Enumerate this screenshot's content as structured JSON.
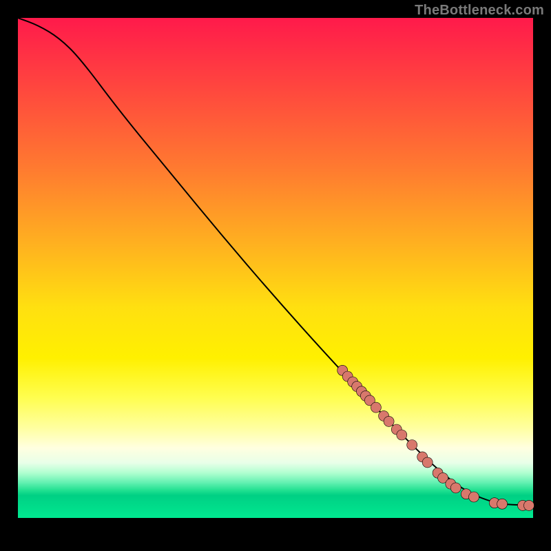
{
  "watermark": "TheBottleneck.com",
  "chart_data": {
    "type": "line",
    "title": "",
    "xlabel": "",
    "ylabel": "",
    "xlim": [
      0,
      100
    ],
    "ylim": [
      0,
      100
    ],
    "curve": [
      {
        "x": 0,
        "y": 100
      },
      {
        "x": 4,
        "y": 98.5
      },
      {
        "x": 8,
        "y": 96
      },
      {
        "x": 12,
        "y": 92
      },
      {
        "x": 20,
        "y": 81
      },
      {
        "x": 30,
        "y": 68.5
      },
      {
        "x": 40,
        "y": 56
      },
      {
        "x": 50,
        "y": 44
      },
      {
        "x": 60,
        "y": 32.5
      },
      {
        "x": 70,
        "y": 21.5
      },
      {
        "x": 78,
        "y": 13
      },
      {
        "x": 84,
        "y": 7.5
      },
      {
        "x": 88,
        "y": 4.8
      },
      {
        "x": 92,
        "y": 3.2
      },
      {
        "x": 95,
        "y": 2.7
      },
      {
        "x": 97,
        "y": 2.6
      },
      {
        "x": 100,
        "y": 2.5
      }
    ],
    "series": [
      {
        "name": "points",
        "color": "#d8786c",
        "data": [
          {
            "x": 63.0,
            "y": 29.5
          },
          {
            "x": 64.0,
            "y": 28.3
          },
          {
            "x": 65.0,
            "y": 27.2
          },
          {
            "x": 65.8,
            "y": 26.3
          },
          {
            "x": 66.7,
            "y": 25.3
          },
          {
            "x": 67.5,
            "y": 24.4
          },
          {
            "x": 68.3,
            "y": 23.5
          },
          {
            "x": 69.5,
            "y": 22.1
          },
          {
            "x": 71.0,
            "y": 20.4
          },
          {
            "x": 72.0,
            "y": 19.3
          },
          {
            "x": 73.5,
            "y": 17.7
          },
          {
            "x": 74.5,
            "y": 16.6
          },
          {
            "x": 76.5,
            "y": 14.6
          },
          {
            "x": 78.5,
            "y": 12.2
          },
          {
            "x": 79.5,
            "y": 11.1
          },
          {
            "x": 81.5,
            "y": 9.0
          },
          {
            "x": 82.5,
            "y": 8.0
          },
          {
            "x": 84.0,
            "y": 6.8
          },
          {
            "x": 85.0,
            "y": 6.0
          },
          {
            "x": 87.0,
            "y": 4.8
          },
          {
            "x": 88.5,
            "y": 4.2
          },
          {
            "x": 92.5,
            "y": 3.0
          },
          {
            "x": 94.0,
            "y": 2.8
          },
          {
            "x": 98.0,
            "y": 2.5
          },
          {
            "x": 99.2,
            "y": 2.5
          }
        ]
      }
    ]
  }
}
